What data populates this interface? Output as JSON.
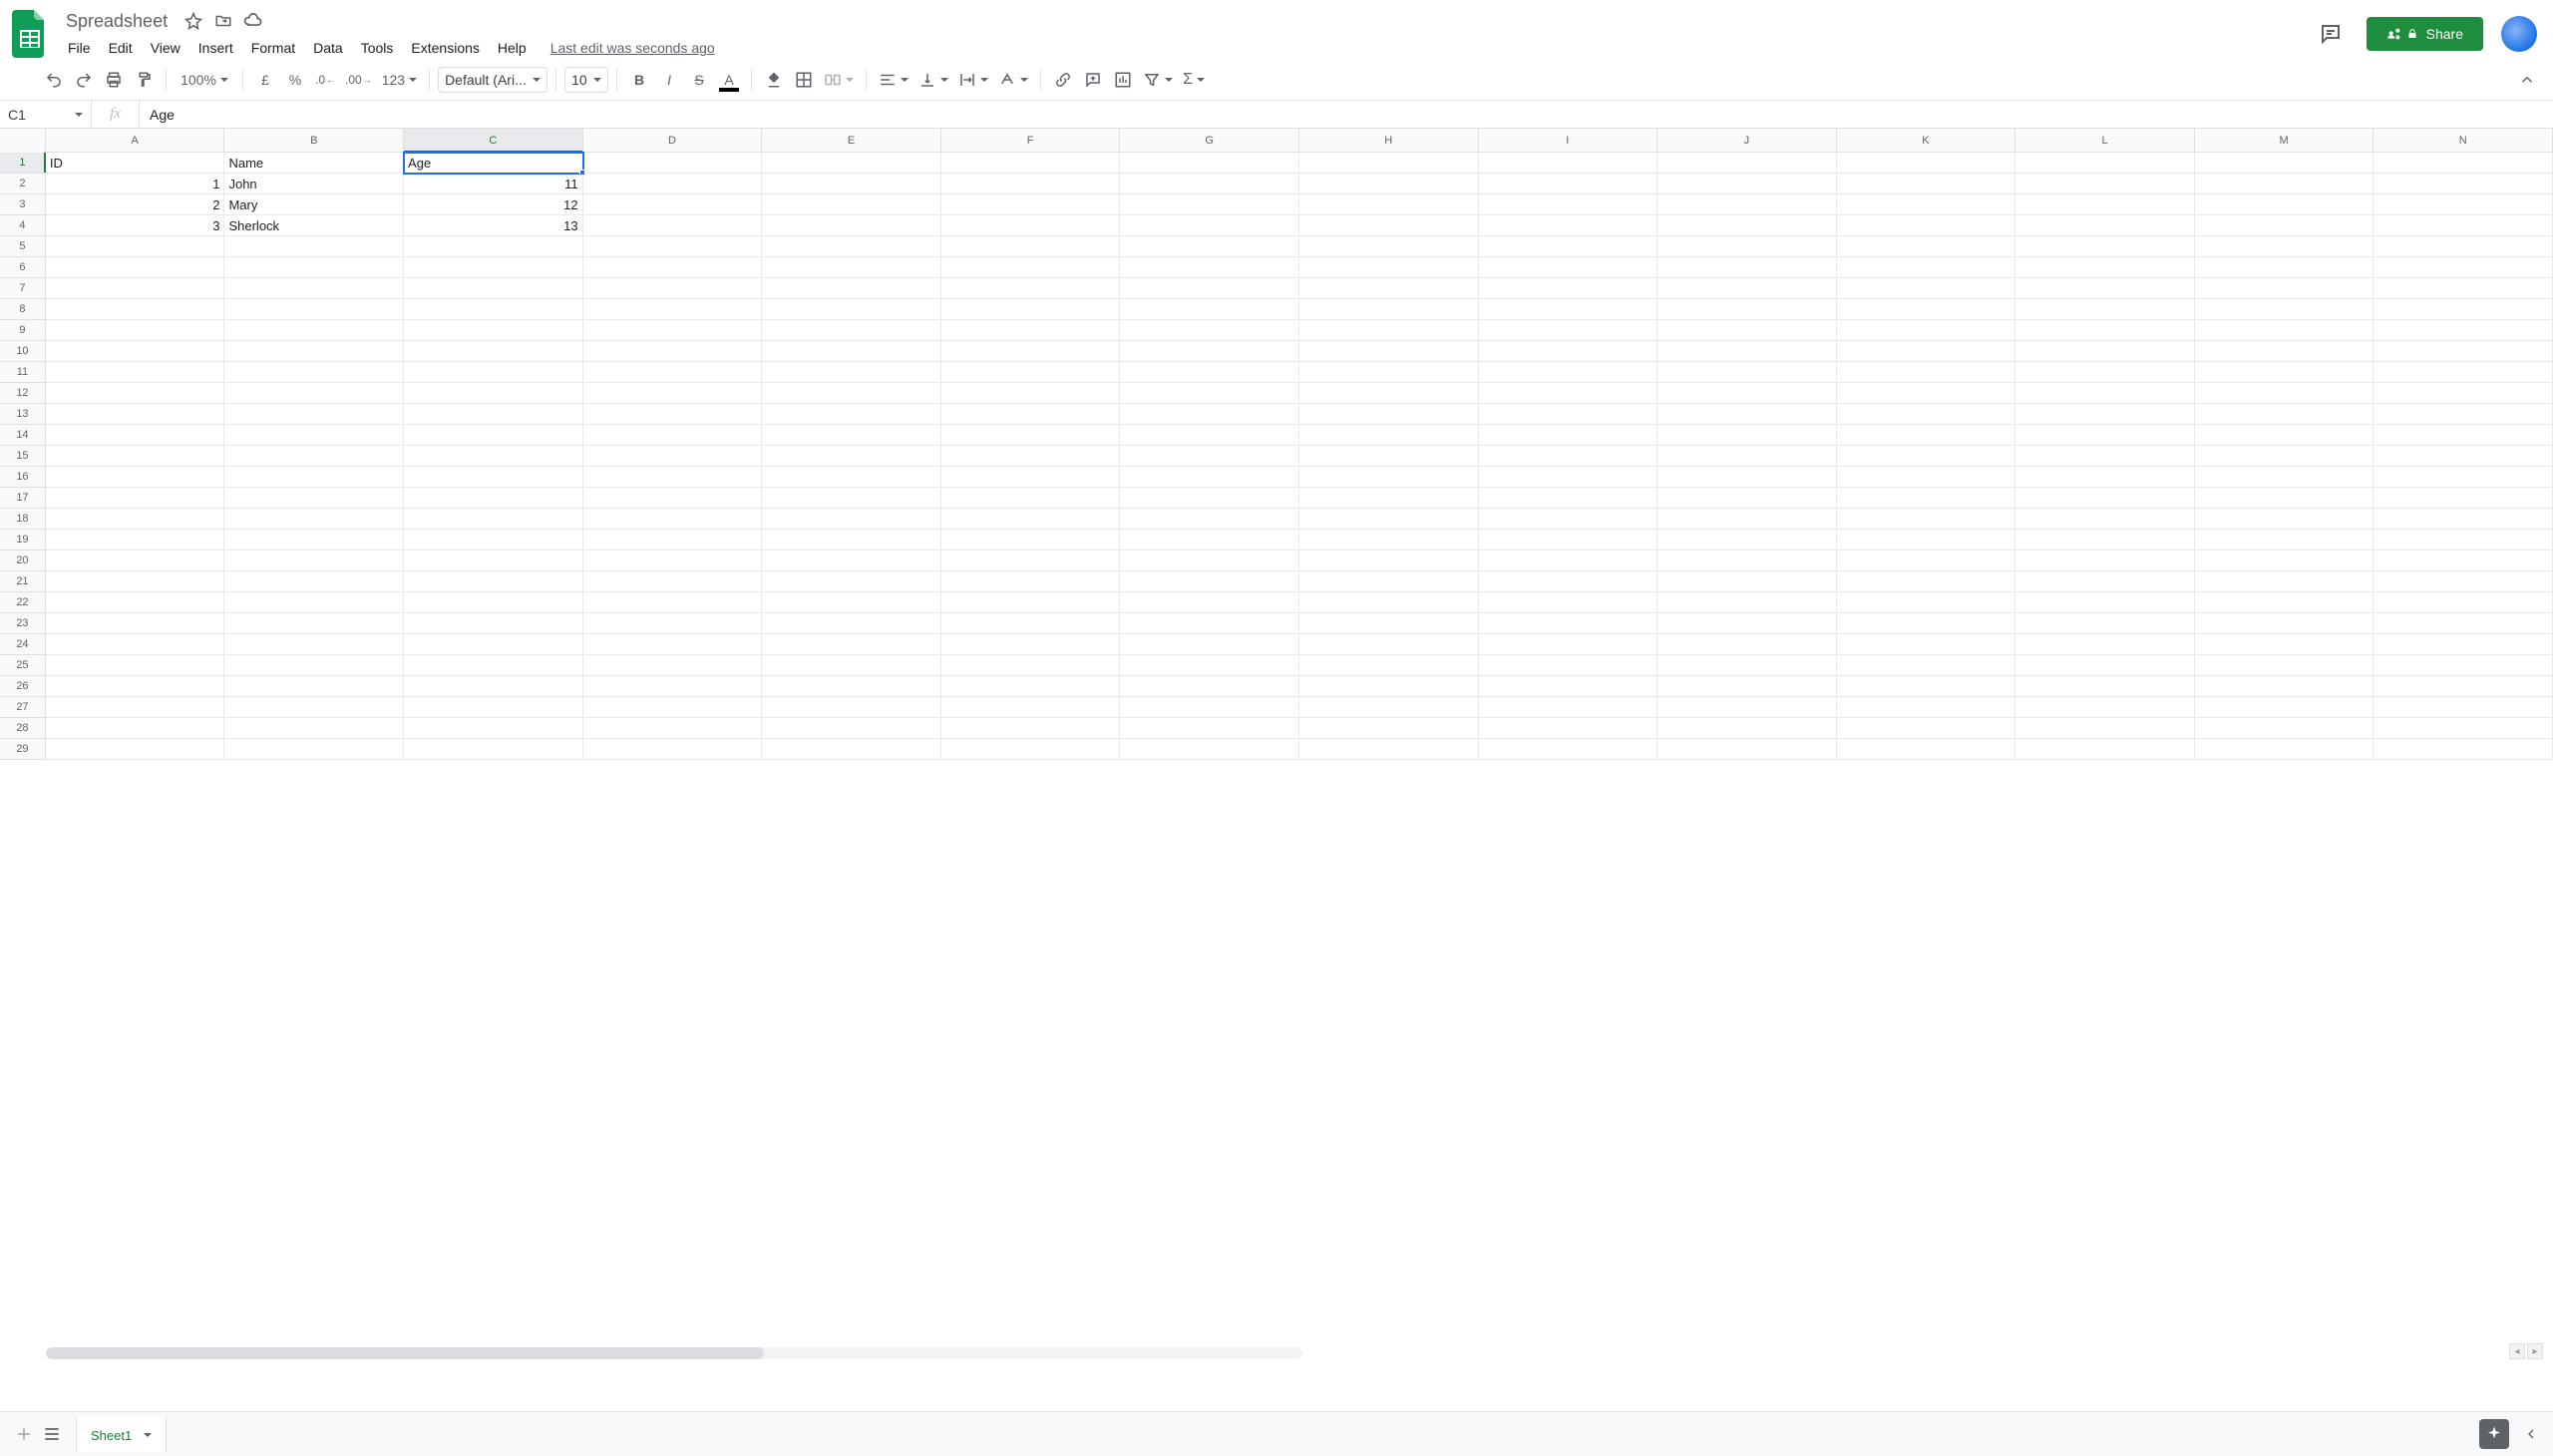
{
  "doc": {
    "title": "Spreadsheet",
    "last_edit": "Last edit was seconds ago"
  },
  "menus": [
    "File",
    "Edit",
    "View",
    "Insert",
    "Format",
    "Data",
    "Tools",
    "Extensions",
    "Help"
  ],
  "share_label": "Share",
  "toolbar": {
    "zoom": "100%",
    "currency": "£",
    "percent": "%",
    "dec_dec": ".0",
    "inc_dec": ".00",
    "numfmt": "123",
    "font": "Default (Ari...",
    "size": "10"
  },
  "namebox": "C1",
  "formula": "Age",
  "columns": [
    "A",
    "B",
    "C",
    "D",
    "E",
    "F",
    "G",
    "H",
    "I",
    "J",
    "K",
    "L",
    "M",
    "N"
  ],
  "selected": {
    "col": 2,
    "row": 0,
    "ref": "C1"
  },
  "sheet_data": {
    "headers_row": 0,
    "rows": [
      {
        "A": "ID",
        "B": "Name",
        "C": "Age"
      },
      {
        "A": 1,
        "B": "John",
        "C": 11
      },
      {
        "A": 2,
        "B": "Mary",
        "C": 12
      },
      {
        "A": 3,
        "B": "Sherlock",
        "C": 13
      }
    ]
  },
  "numeric_columns": [
    "A",
    "C"
  ],
  "total_rows": 29,
  "sheet_tab": "Sheet1",
  "chart_data": {
    "type": "table",
    "columns": [
      "ID",
      "Name",
      "Age"
    ],
    "rows": [
      [
        1,
        "John",
        11
      ],
      [
        2,
        "Mary",
        12
      ],
      [
        3,
        "Sherlock",
        13
      ]
    ]
  }
}
